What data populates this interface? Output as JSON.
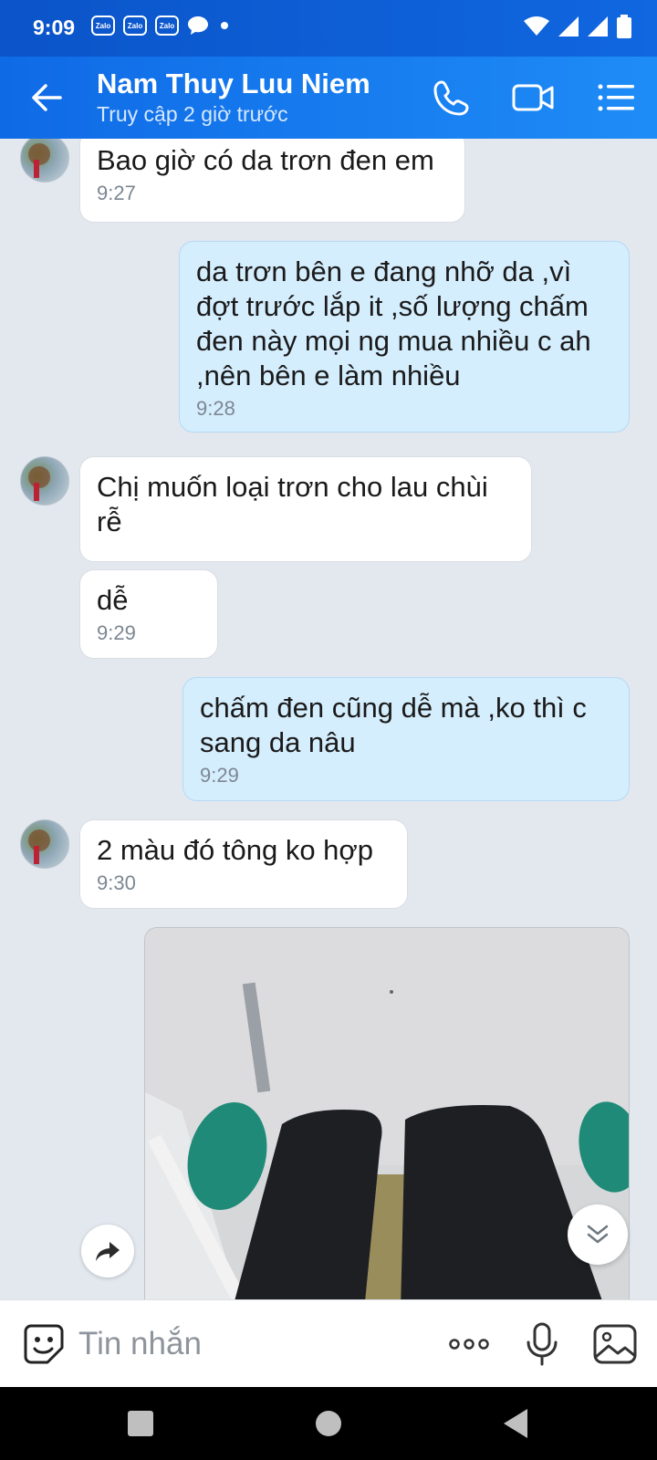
{
  "status_bar": {
    "time": "9:09",
    "notifications": [
      "Zalo",
      "Zalo",
      "Zalo"
    ]
  },
  "header": {
    "contact_name": "Nam Thuy Luu Niem",
    "last_seen": "Truy cập 2 giờ trước"
  },
  "messages": [
    {
      "side": "in",
      "text": "Bao giờ có da trơn đen em",
      "time": "9:27"
    },
    {
      "side": "out",
      "text": "da trơn bên e đang nhỡ da ,vì đợt trước lắp it ,số lượng chấm đen này mọi ng mua nhiều c ah ,nên bên e làm nhiều",
      "time": "9:28"
    },
    {
      "side": "in",
      "text": "Chị muốn loại trơn cho lau chùi rễ",
      "time": ""
    },
    {
      "side": "in",
      "text": "dễ",
      "time": "9:29"
    },
    {
      "side": "out",
      "text": "chấm đen cũng dễ mà ,ko thì c sang da nâu",
      "time": "9:29"
    },
    {
      "side": "in",
      "text": "2 màu đó tông ko hợp",
      "time": "9:30"
    }
  ],
  "composer": {
    "placeholder": "Tin nhắn"
  },
  "colors": {
    "header": "#1e8cf6",
    "bubble_out": "#d5eefe",
    "chat_bg": "#e3e8ef"
  }
}
